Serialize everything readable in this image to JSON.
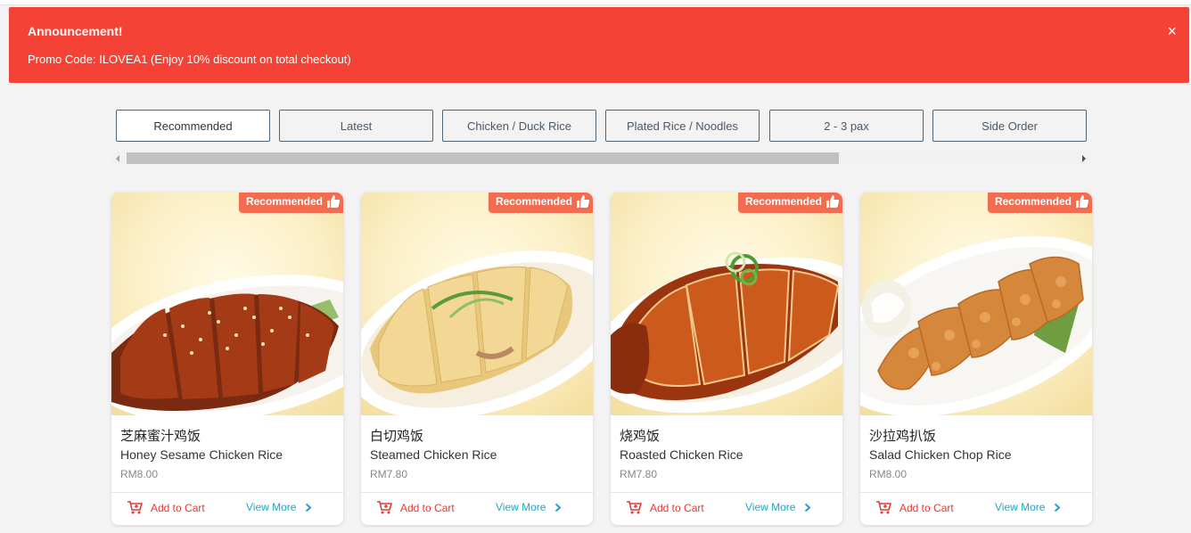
{
  "announcement": {
    "title": "Announcement!",
    "message": "Promo Code: ILOVEA1 (Enjoy 10% discount on total checkout)",
    "close_symbol": "×",
    "background_color": "#f44336"
  },
  "category_tabs": [
    {
      "label": "Recommended",
      "active": true
    },
    {
      "label": "Latest",
      "active": false
    },
    {
      "label": "Chicken / Duck Rice",
      "active": false
    },
    {
      "label": "Plated Rice / Noodles",
      "active": false
    },
    {
      "label": "2 - 3 pax",
      "active": false
    },
    {
      "label": "Side Order",
      "active": false
    }
  ],
  "products": [
    {
      "badge": "Recommended",
      "name_cn": "芝麻蜜汁鸡饭",
      "name_en": "Honey Sesame Chicken Rice",
      "price": "RM8.00",
      "add_label": "Add to Cart",
      "view_label": "View More",
      "image": "honey-sesame-chicken"
    },
    {
      "badge": "Recommended",
      "name_cn": "白切鸡饭",
      "name_en": "Steamed Chicken Rice",
      "price": "RM7.80",
      "add_label": "Add to Cart",
      "view_label": "View More",
      "image": "steamed-chicken"
    },
    {
      "badge": "Recommended",
      "name_cn": "烧鸡饭",
      "name_en": "Roasted Chicken Rice",
      "price": "RM7.80",
      "add_label": "Add to Cart",
      "view_label": "View More",
      "image": "roasted-chicken"
    },
    {
      "badge": "Recommended",
      "name_cn": "沙拉鸡扒饭",
      "name_en": "Salad Chicken Chop Rice",
      "price": "RM8.00",
      "add_label": "Add to Cart",
      "view_label": "View More",
      "image": "salad-chicken-chop"
    }
  ],
  "colors": {
    "badge": "#f26c4f",
    "add_to_cart": "#e53935",
    "view_more": "#1ba6c4",
    "tab_border": "#4f6475"
  },
  "icons": {
    "badge": "thumbs-up-icon",
    "add": "cart-icon",
    "view": "chevron-right-icon",
    "close": "close-icon"
  }
}
